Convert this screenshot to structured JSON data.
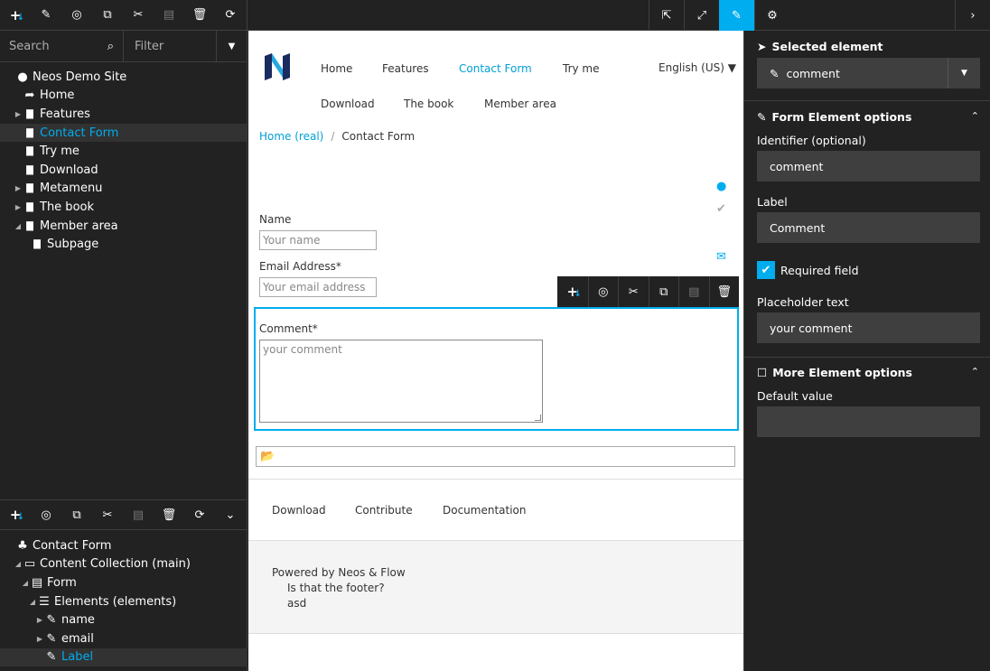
{
  "left_toolbar": {
    "icons": [
      "add-node-icon",
      "pencil-icon",
      "eye-slash-icon",
      "copy-icon",
      "cut-icon",
      "paste-icon",
      "delete-icon",
      "refresh-icon"
    ]
  },
  "search": {
    "placeholder": "Search"
  },
  "filter": {
    "placeholder": "Filter"
  },
  "page_tree": [
    {
      "label": "Neos Demo Site",
      "icon": "globe-icon",
      "toggle": "",
      "indent": 0
    },
    {
      "label": "Home",
      "icon": "share-icon",
      "toggle": "",
      "indent": 1
    },
    {
      "label": "Features",
      "icon": "file-icon",
      "toggle": "▶",
      "indent": 1
    },
    {
      "label": "Contact Form",
      "icon": "file-icon",
      "toggle": "",
      "indent": 1,
      "active": true
    },
    {
      "label": "Try me",
      "icon": "file-icon",
      "toggle": "",
      "indent": 1
    },
    {
      "label": "Download",
      "icon": "file-icon",
      "toggle": "",
      "indent": 1
    },
    {
      "label": "Metamenu",
      "icon": "file-icon",
      "toggle": "▶",
      "indent": 1
    },
    {
      "label": "The book",
      "icon": "file-icon",
      "toggle": "▶",
      "indent": 1
    },
    {
      "label": "Member area",
      "icon": "file-icon",
      "toggle": "◢",
      "indent": 1
    },
    {
      "label": "Subpage",
      "icon": "file-icon",
      "toggle": "",
      "indent": 2
    }
  ],
  "content_tree": [
    {
      "label": "Contact Form",
      "icon": "sitemap-icon",
      "toggle": "",
      "indent": 0
    },
    {
      "label": "Content Collection (main)",
      "icon": "folder-open-icon",
      "toggle": "◢",
      "indent": 1
    },
    {
      "label": "Form",
      "icon": "form-icon",
      "toggle": "◢",
      "indent": 2
    },
    {
      "label": "Elements (elements)",
      "icon": "list-icon",
      "toggle": "◢",
      "indent": 3
    },
    {
      "label": "name",
      "icon": "edit-icon",
      "toggle": "▶",
      "indent": 4
    },
    {
      "label": "email",
      "icon": "edit-icon",
      "toggle": "▶",
      "indent": 4
    },
    {
      "label": "Label",
      "icon": "edit-icon",
      "toggle": "",
      "indent": 4,
      "active": true
    }
  ],
  "page": {
    "nav_row1": [
      "Home",
      "Features",
      "Contact Form",
      "Try me"
    ],
    "nav_row2": [
      "Download",
      "The book",
      "Member area"
    ],
    "language": "English (US) ▼",
    "breadcrumb_home": "Home (real)",
    "breadcrumb_sep": "/",
    "breadcrumb_current": "Contact Form",
    "name_label": "Name",
    "name_placeholder": "Your name",
    "email_label": "Email Address*",
    "email_placeholder": "Your email address",
    "comment_label": "Comment*",
    "comment_placeholder": "your comment",
    "footer_nav": [
      "Download",
      "Contribute",
      "Documentation"
    ],
    "footer_powered": "Powered by Neos & Flow",
    "footer_line2": "Is that the footer?",
    "footer_line3": "asd"
  },
  "inspector": {
    "selected_title": "Selected element",
    "selected_value": "comment",
    "form_options_title": "Form Element options",
    "identifier_label": "Identifier (optional)",
    "identifier_value": "comment",
    "label_label": "Label",
    "label_value": "Comment",
    "required_label": "Required field",
    "required_checked": true,
    "placeholder_label": "Placeholder text",
    "placeholder_value": "your comment",
    "more_options_title": "More Element options",
    "default_label": "Default value",
    "default_value": ""
  },
  "colors": {
    "accent": "#00adee",
    "panel": "#222222",
    "field": "#3f3f3f"
  }
}
